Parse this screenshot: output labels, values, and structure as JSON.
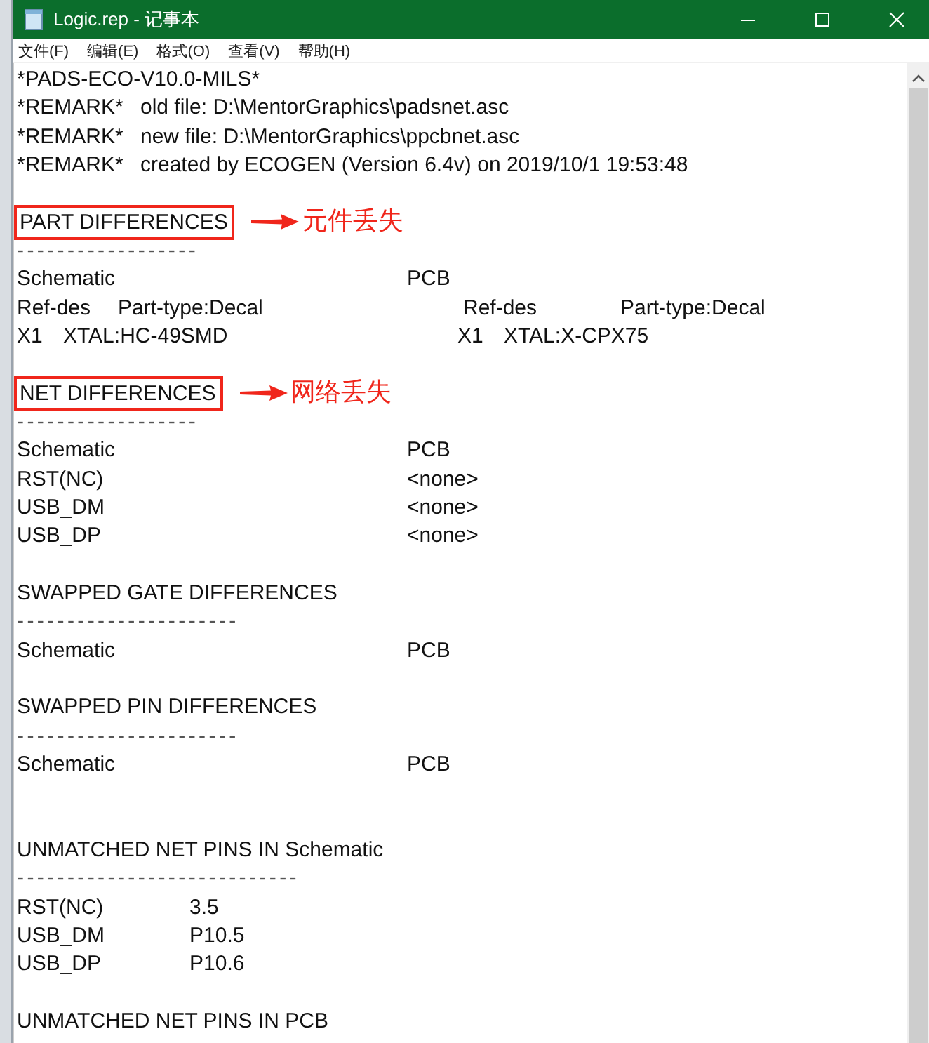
{
  "window": {
    "title": "Logic.rep - 记事本"
  },
  "menu": [
    "文件(F)",
    "编辑(E)",
    "格式(O)",
    "查看(V)",
    "帮助(H)"
  ],
  "lines": [
    {
      "kind": "text",
      "cells": [
        "*PADS-ECO-V10.0-MILS*"
      ]
    },
    {
      "kind": "remark",
      "cells": [
        "*REMARK*",
        "old file: D:\\MentorGraphics\\padsnet.asc"
      ]
    },
    {
      "kind": "remark",
      "cells": [
        "*REMARK*",
        "new file: D:\\MentorGraphics\\ppcbnet.asc"
      ]
    },
    {
      "kind": "remark",
      "cells": [
        "*REMARK*",
        "created by ECOGEN (Version 6.4v) on 2019/10/1 19:53:48"
      ]
    },
    {
      "kind": "blank"
    },
    {
      "kind": "heading",
      "cells": [
        "PART DIFFERENCES"
      ],
      "note": "元件丢失"
    },
    {
      "kind": "rule",
      "cells": [
        "------------------"
      ]
    },
    {
      "kind": "columns",
      "cells": [
        "Schematic",
        "PCB"
      ]
    },
    {
      "kind": "parthead",
      "cells": [
        "Ref-des",
        "Part-type:Decal",
        "Ref-des",
        "Part-type:Decal"
      ]
    },
    {
      "kind": "partrow",
      "cells": [
        "X1",
        "XTAL:HC-49SMD",
        "X1",
        "XTAL:X-CPX75"
      ]
    },
    {
      "kind": "blank"
    },
    {
      "kind": "heading",
      "cells": [
        "NET DIFFERENCES"
      ],
      "note": "网络丢失"
    },
    {
      "kind": "rule",
      "cells": [
        "------------------"
      ]
    },
    {
      "kind": "columns",
      "cells": [
        "Schematic",
        "PCB"
      ]
    },
    {
      "kind": "columns",
      "cells": [
        "RST(NC)",
        "<none>"
      ]
    },
    {
      "kind": "columns",
      "cells": [
        "USB_DM",
        "<none>"
      ]
    },
    {
      "kind": "columns",
      "cells": [
        "USB_DP",
        "<none>"
      ]
    },
    {
      "kind": "blank"
    },
    {
      "kind": "text",
      "cells": [
        "SWAPPED GATE DIFFERENCES"
      ]
    },
    {
      "kind": "rule",
      "cells": [
        "----------------------"
      ]
    },
    {
      "kind": "columns",
      "cells": [
        "Schematic",
        "PCB"
      ]
    },
    {
      "kind": "blank"
    },
    {
      "kind": "text",
      "cells": [
        "SWAPPED PIN DIFFERENCES"
      ]
    },
    {
      "kind": "rule",
      "cells": [
        "----------------------"
      ]
    },
    {
      "kind": "columns",
      "cells": [
        "Schematic",
        "PCB"
      ]
    },
    {
      "kind": "blank"
    },
    {
      "kind": "blank"
    },
    {
      "kind": "text",
      "cells": [
        "UNMATCHED NET PINS IN Schematic"
      ]
    },
    {
      "kind": "rule",
      "cells": [
        "----------------------------"
      ]
    },
    {
      "kind": "pins",
      "cells": [
        "RST(NC)",
        "3.5"
      ]
    },
    {
      "kind": "pins",
      "cells": [
        "USB_DM",
        "P10.5"
      ]
    },
    {
      "kind": "pins",
      "cells": [
        "USB_DP",
        "P10.6"
      ]
    },
    {
      "kind": "blank"
    },
    {
      "kind": "text",
      "cells": [
        "UNMATCHED NET PINS IN PCB"
      ]
    }
  ]
}
